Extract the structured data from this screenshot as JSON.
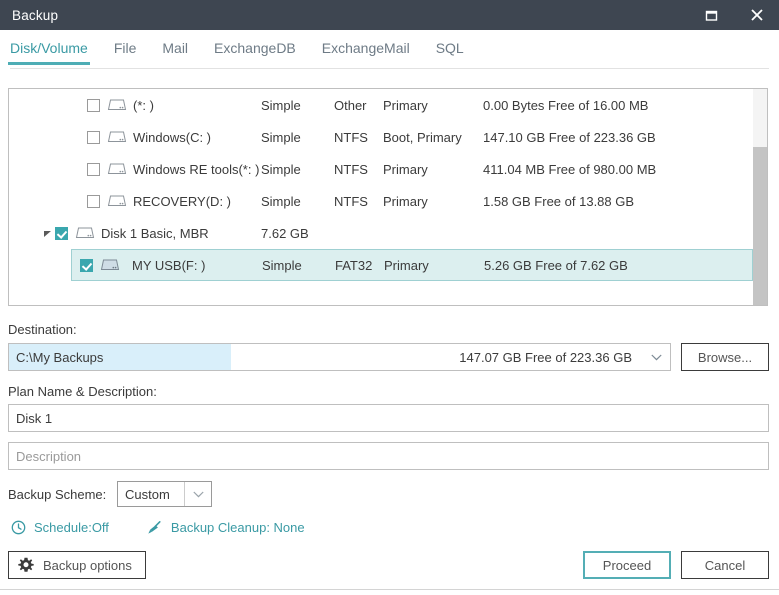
{
  "window": {
    "title": "Backup",
    "titlebar_color": "#3e4651",
    "accent_color": "#4eadb5",
    "controls": [
      {
        "name": "maximize-button",
        "icon": "maximize-icon"
      },
      {
        "name": "close-button",
        "icon": "close-icon"
      }
    ]
  },
  "tabs": [
    {
      "label": "Disk/Volume",
      "active": true
    },
    {
      "label": "File",
      "active": false
    },
    {
      "label": "Mail",
      "active": false
    },
    {
      "label": "ExchangeDB",
      "active": false
    },
    {
      "label": "ExchangeMail",
      "active": false
    },
    {
      "label": "SQL",
      "active": false
    }
  ],
  "disk_list": {
    "rows": [
      {
        "name": "(*: )",
        "type": "Simple",
        "filesystem": "Other",
        "flags": "Primary",
        "space": "0.00 Bytes Free of 16.00 MB",
        "checked": false,
        "selected": false,
        "kind": "volume"
      },
      {
        "name": "Windows(C: )",
        "type": "Simple",
        "filesystem": "NTFS",
        "flags": "Boot, Primary",
        "space": "147.10 GB Free of 223.36 GB",
        "checked": false,
        "selected": false,
        "kind": "volume"
      },
      {
        "name": "Windows RE tools(*: )",
        "type": "Simple",
        "filesystem": "NTFS",
        "flags": "Primary",
        "space": "411.04 MB Free of 980.00 MB",
        "checked": false,
        "selected": false,
        "kind": "volume"
      },
      {
        "name": "RECOVERY(D: )",
        "type": "Simple",
        "filesystem": "NTFS",
        "flags": "Primary",
        "space": "1.58 GB Free of 13.88 GB",
        "checked": false,
        "selected": false,
        "kind": "volume"
      },
      {
        "name": "Disk 1 Basic, MBR",
        "type": "7.62 GB",
        "filesystem": "",
        "flags": "",
        "space": "",
        "checked": true,
        "selected": false,
        "kind": "disk"
      },
      {
        "name": "MY USB(F: )",
        "type": "Simple",
        "filesystem": "FAT32",
        "flags": "Primary",
        "space": "5.26 GB Free of 7.62 GB",
        "checked": true,
        "selected": true,
        "kind": "volume"
      }
    ]
  },
  "destination": {
    "label": "Destination:",
    "path": "C:\\My Backups",
    "free_space": "147.07 GB Free of 223.36 GB",
    "browse_label": "Browse..."
  },
  "plan": {
    "label": "Plan Name & Description:",
    "name_value": "Disk 1",
    "description_placeholder": "Description",
    "description_value": ""
  },
  "scheme": {
    "label": "Backup Scheme:",
    "value": "Custom"
  },
  "status": {
    "schedule": "Schedule:Off",
    "cleanup": "Backup Cleanup: None",
    "link_color": "#3a9aa4"
  },
  "actions": {
    "options_label": "Backup options",
    "proceed_label": "Proceed",
    "cancel_label": "Cancel"
  }
}
